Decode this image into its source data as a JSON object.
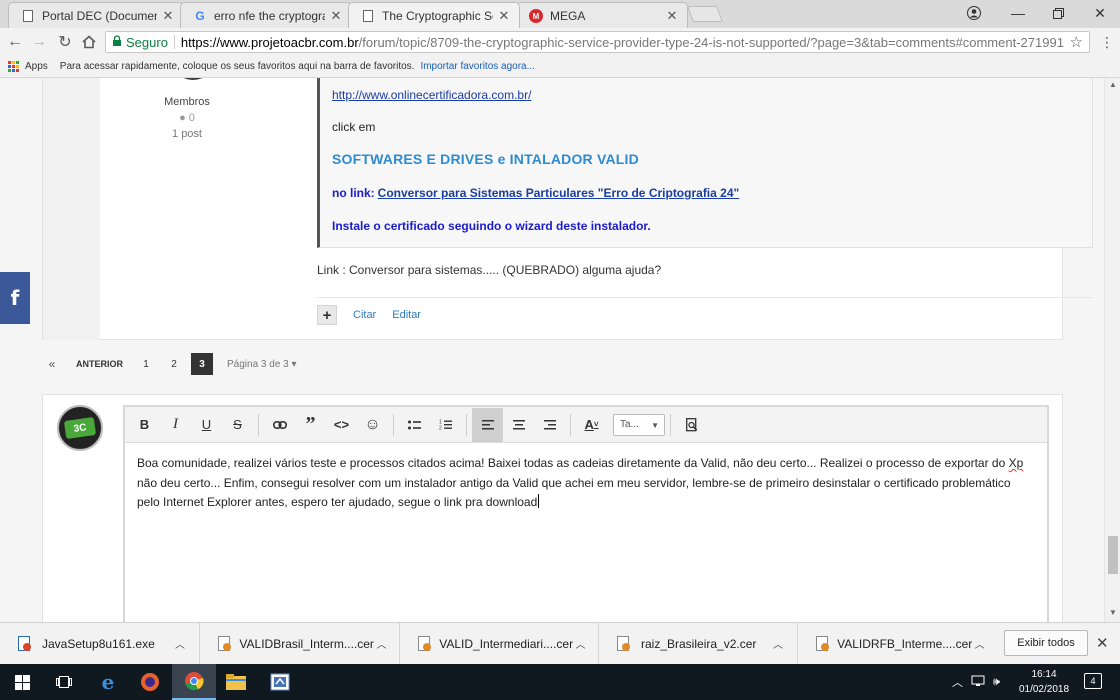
{
  "browser": {
    "tabs": [
      {
        "title": "Portal DEC (Documento E",
        "icon": "document-icon"
      },
      {
        "title": "erro nfe the cryptograph",
        "icon": "google-icon"
      },
      {
        "title": "The Cryptographic Servic",
        "icon": "document-icon",
        "active": true
      },
      {
        "title": "MEGA",
        "icon": "mega-icon"
      }
    ],
    "security_label": "Seguro",
    "url_host": "https://www.projetoacbr.com.br",
    "url_path": "/forum/topic/8709-the-cryptographic-service-provider-type-24-is-not-supported/?page=3&tab=comments#comment-271991",
    "apps_label": "Apps",
    "bookmarks_hint": "Para acessar rapidamente, coloque os seus favoritos aqui na barra de favoritos.",
    "bookmarks_import": "Importar favoritos agora..."
  },
  "post": {
    "author_role": "Membros",
    "author_rep": "0",
    "author_posts": "1 post",
    "quote_link": "http://www.onlinecertificadora.com.br/",
    "quote_click": "click em",
    "quote_heading": "SOFTWARES E DRIVES e INTALADOR VALID",
    "quote_nolink_label": "no link:",
    "quote_nolink_target": "Conversor para Sistemas Particulares \"Erro de Criptografia 24\"",
    "quote_install": "Instale o certificado seguindo o wizard deste instalador.",
    "body": "Link : Conversor para sistemas..... (QUEBRADO) alguma ajuda?",
    "action_plus": "+",
    "action_quote": "Citar",
    "action_edit": "Editar"
  },
  "pagination": {
    "first": "«",
    "prev_label": "ANTERIOR",
    "pages": [
      "1",
      "2"
    ],
    "current": "3",
    "info": "Página 3 de 3"
  },
  "editor": {
    "font_select": "Ta...",
    "text_line1": "Boa comunidade, realizei vários teste e processos citados acima! Baixei todas as cadeias diretamente da Valid, não deu certo... Realizei o processo de exportar do",
    "text_misspelled": "Xp",
    "text_line2": " não deu certo... Enfim, consegui resolver com um instalador antigo da Valid que achei em meu servidor, lembre-se de primeiro desinstalar o certificado",
    "text_line3": "problemático pelo Internet Explorer antes, espero ter ajudado, segue o link pra download"
  },
  "downloads": {
    "items": [
      {
        "name": "JavaSetup8u161.exe",
        "icon": "java-installer-icon"
      },
      {
        "name": "VALIDBrasil_Interm....cer",
        "icon": "certificate-icon"
      },
      {
        "name": "VALID_Intermediari....cer",
        "icon": "certificate-icon"
      },
      {
        "name": "raiz_Brasileira_v2.cer",
        "icon": "certificate-icon"
      },
      {
        "name": "VALIDRFB_Interme....cer",
        "icon": "certificate-icon"
      }
    ],
    "show_all": "Exibir todos"
  },
  "taskbar": {
    "time": "16:14",
    "date": "01/02/2018",
    "notifications": "4"
  }
}
